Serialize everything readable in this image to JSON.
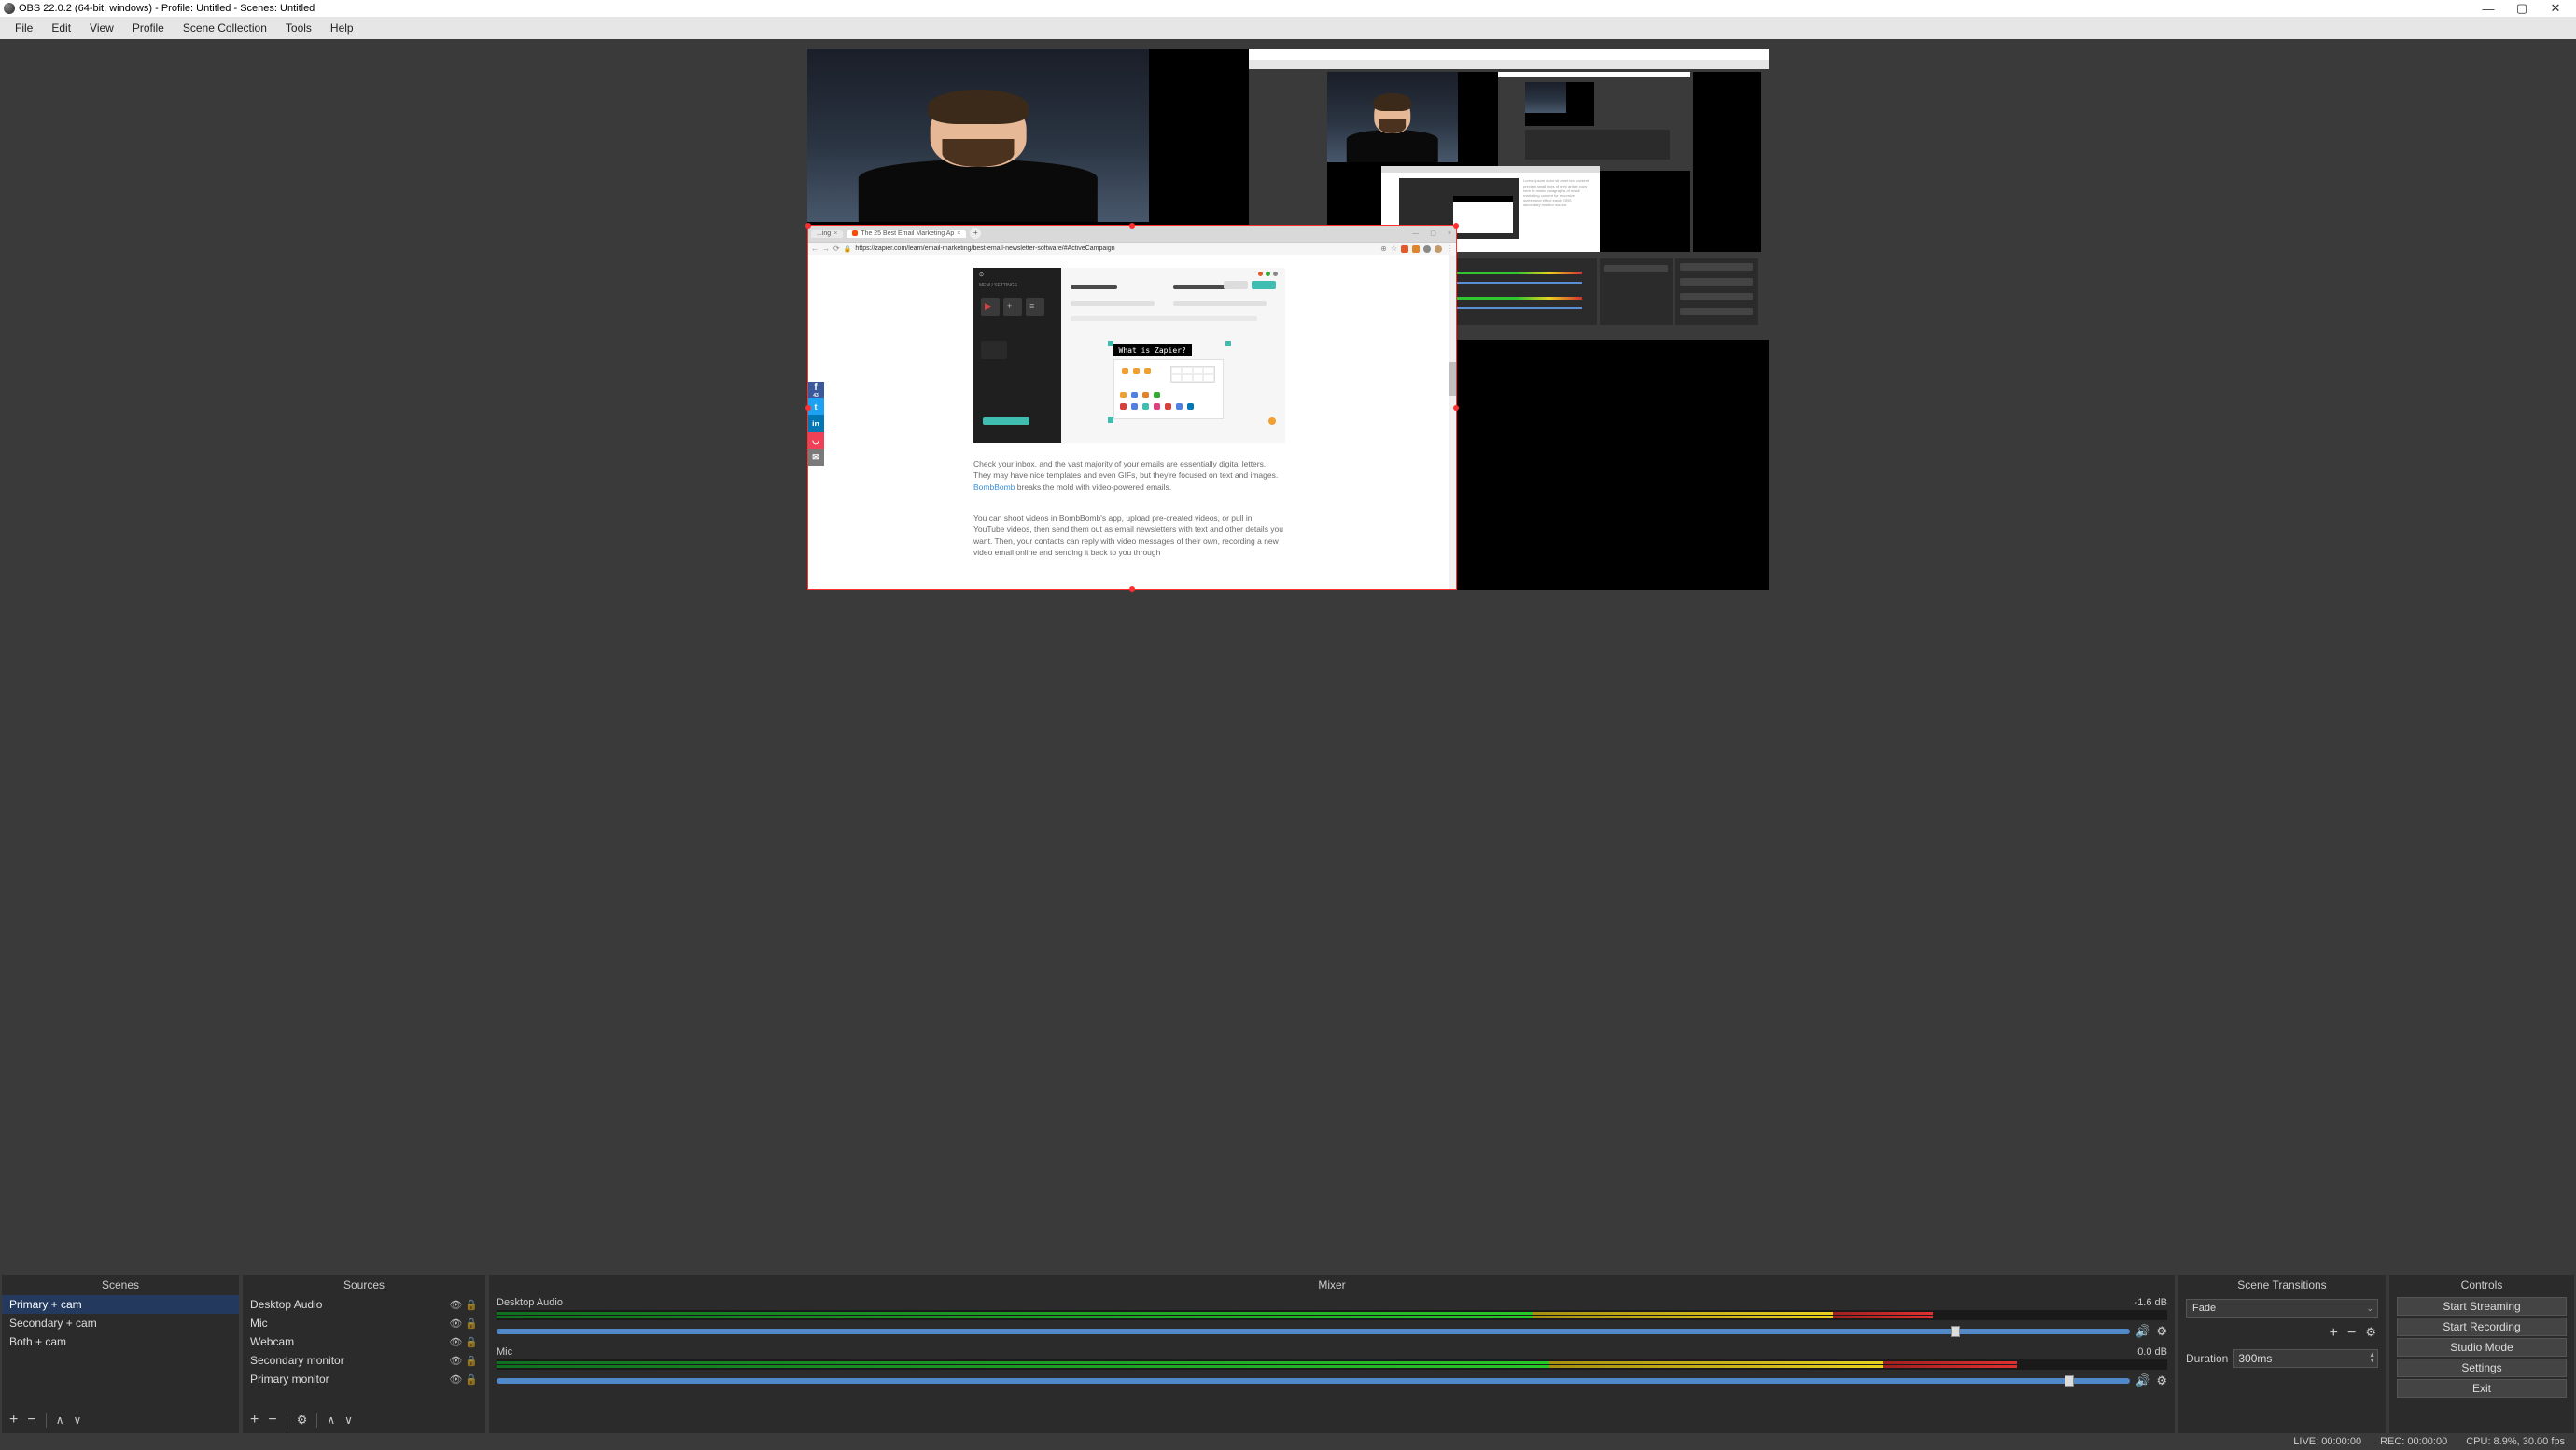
{
  "titlebar": {
    "title": "OBS 22.0.2 (64-bit, windows) - Profile: Untitled - Scenes: Untitled"
  },
  "menus": [
    "File",
    "Edit",
    "View",
    "Profile",
    "Scene Collection",
    "Tools",
    "Help"
  ],
  "browser": {
    "tab_inactive": "...ing",
    "tab_active": "The 25 Best Email Marketing Ap",
    "url": "https://zapier.com/learn/email-marketing/best-email-newsletter-software/#ActiveCampaign",
    "zap_title": "What is Zapier?",
    "fb_count": "43",
    "article_p1a": "Check your inbox, and the vast majority of your emails are essentially digital letters. They may have nice templates and even GIFs, but they're focused on text and images. ",
    "article_link": "BombBomb",
    "article_p1b": " breaks the mold with video-powered emails.",
    "article_p2": "You can shoot videos in BombBomb's app, upload pre-created videos, or pull in YouTube videos, then send them out as email newsletters with text and other details you want. Then, your contacts can reply with video messages of their own, recording a new video email online and sending it back to you through"
  },
  "panels": {
    "scenes": "Scenes",
    "sources": "Sources",
    "mixer": "Mixer",
    "transitions": "Scene Transitions",
    "controls": "Controls"
  },
  "scenes": [
    {
      "name": "Primary + cam",
      "selected": true
    },
    {
      "name": "Secondary + cam",
      "selected": false
    },
    {
      "name": "Both + cam",
      "selected": false
    }
  ],
  "sources": [
    {
      "name": "Desktop Audio"
    },
    {
      "name": "Mic"
    },
    {
      "name": "Webcam"
    },
    {
      "name": "Secondary monitor"
    },
    {
      "name": "Primary monitor"
    }
  ],
  "mixer": {
    "track1": {
      "name": "Desktop Audio",
      "db": "-1.6 dB",
      "green_pct": 62,
      "yellow_pct": 18,
      "red_pct": 6,
      "slider_pct": 89
    },
    "track2": {
      "name": "Mic",
      "db": "0.0 dB",
      "green_pct": 63,
      "yellow_pct": 20,
      "red_pct": 8,
      "slider_pct": 96
    }
  },
  "transitions": {
    "selected": "Fade",
    "duration_label": "Duration",
    "duration_value": "300ms"
  },
  "controls": [
    "Start Streaming",
    "Start Recording",
    "Studio Mode",
    "Settings",
    "Exit"
  ],
  "status": {
    "live": "LIVE: 00:00:00",
    "rec": "REC: 00:00:00",
    "cpu": "CPU: 8.9%, 30.00 fps"
  }
}
